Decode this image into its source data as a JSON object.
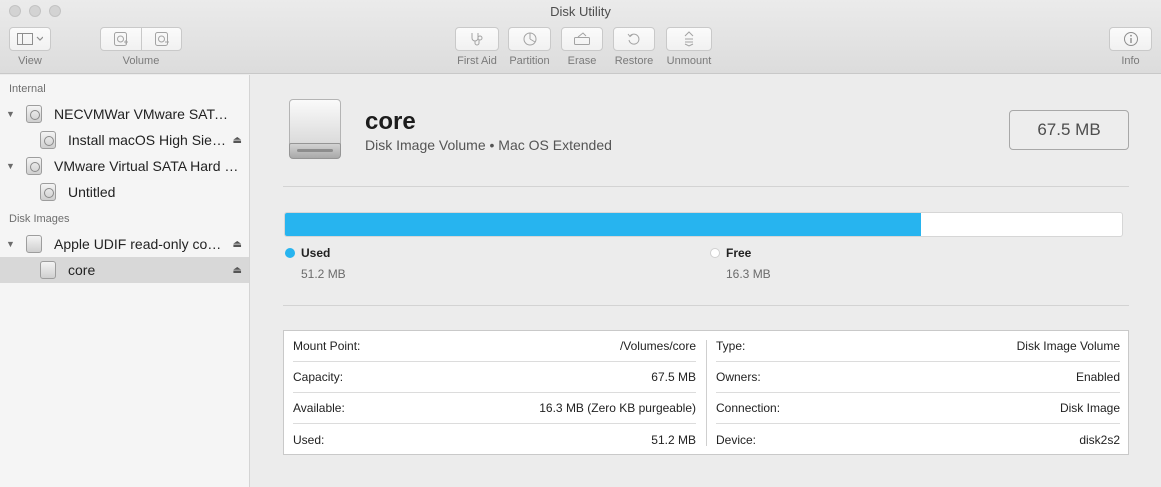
{
  "window": {
    "title": "Disk Utility"
  },
  "toolbar": {
    "view": {
      "label": "View",
      "icon": "sidebar-icon"
    },
    "volume": {
      "label": "Volume",
      "add_icon": "add-volume-icon",
      "remove_icon": "remove-volume-icon"
    },
    "actions": [
      {
        "label": "First Aid",
        "icon": "stethoscope-icon"
      },
      {
        "label": "Partition",
        "icon": "partition-icon"
      },
      {
        "label": "Erase",
        "icon": "erase-icon"
      },
      {
        "label": "Restore",
        "icon": "restore-icon"
      },
      {
        "label": "Unmount",
        "icon": "unmount-icon"
      }
    ],
    "info": {
      "label": "Info",
      "icon": "info-icon"
    }
  },
  "sidebar": {
    "sections": [
      {
        "label": "Internal"
      },
      {
        "label": "Disk Images"
      }
    ],
    "items": [
      {
        "label": "NECVMWar VMware SATA...",
        "expanded": true
      },
      {
        "label": "Install macOS High Sierra",
        "eject": "⏏"
      },
      {
        "label": "VMware Virtual SATA Hard Dr...",
        "expanded": true
      },
      {
        "label": "Untitled"
      },
      {
        "label": "Apple UDIF read-only com...",
        "expanded": true,
        "eject": "⏏"
      },
      {
        "label": "core",
        "eject": "⏏",
        "selected": true
      }
    ]
  },
  "volume": {
    "name": "core",
    "description": "Disk Image Volume • Mac OS Extended",
    "size": "67.5 MB"
  },
  "usage": {
    "used_fraction": 0.76,
    "used_color": "#27b4ef",
    "free_color": "#ffffff",
    "used_label": "Used",
    "used_value": "51.2 MB",
    "free_label": "Free",
    "free_value": "16.3 MB"
  },
  "info": {
    "left": [
      {
        "key": "Mount Point:",
        "value": "/Volumes/core"
      },
      {
        "key": "Capacity:",
        "value": "67.5 MB"
      },
      {
        "key": "Available:",
        "value": "16.3 MB (Zero KB purgeable)"
      },
      {
        "key": "Used:",
        "value": "51.2 MB"
      }
    ],
    "right": [
      {
        "key": "Type:",
        "value": "Disk Image Volume"
      },
      {
        "key": "Owners:",
        "value": "Enabled"
      },
      {
        "key": "Connection:",
        "value": "Disk Image"
      },
      {
        "key": "Device:",
        "value": "disk2s2"
      }
    ]
  }
}
